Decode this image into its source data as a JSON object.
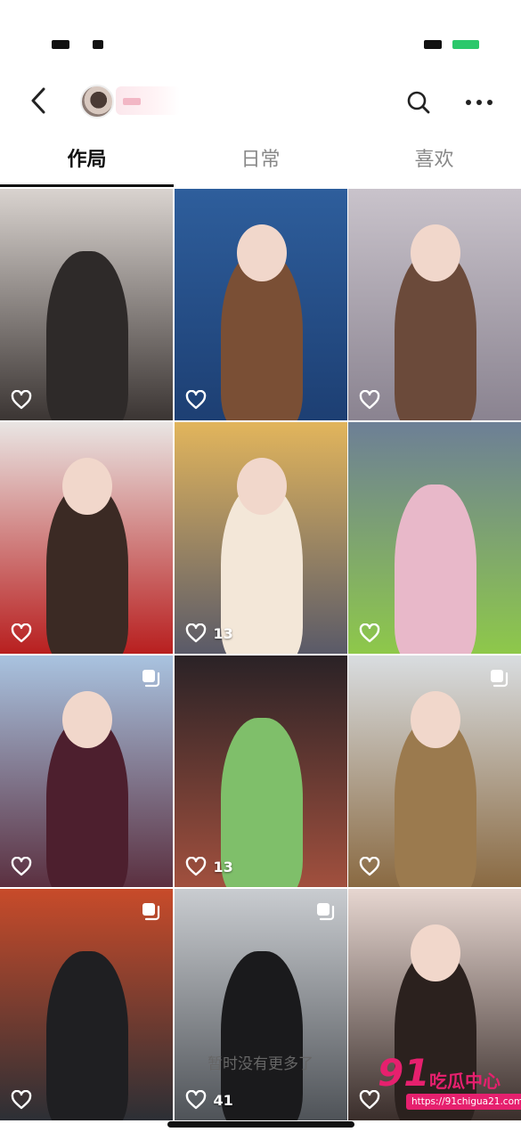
{
  "status_bar": {
    "left_blocks": 2,
    "battery_color": "#2bc86b"
  },
  "header": {
    "back_icon": "chevron-left-icon",
    "search_icon": "search-icon",
    "more_icon": "more-horizontal-icon"
  },
  "tabs": [
    {
      "label": "作局",
      "active": true
    },
    {
      "label": "日常",
      "active": false
    },
    {
      "label": "喜欢",
      "active": false
    }
  ],
  "grid": {
    "items": [
      {
        "likes": "",
        "multi": false,
        "bg": [
          "#d9d3cf",
          "#3b3533"
        ],
        "figure": "#2e2a29",
        "face": false
      },
      {
        "likes": "",
        "multi": false,
        "bg": [
          "#2e5e9c",
          "#1d3f73"
        ],
        "figure": "#7a4f35",
        "face": true
      },
      {
        "likes": "",
        "multi": false,
        "bg": [
          "#c9c3cb",
          "#8a8390"
        ],
        "figure": "#6b4a3a",
        "face": true
      },
      {
        "likes": "",
        "multi": false,
        "bg": [
          "#e9e5e3",
          "#b81f1f"
        ],
        "figure": "#3b2a24",
        "face": true
      },
      {
        "likes": "13",
        "multi": false,
        "bg": [
          "#e2b55c",
          "#5a5a68"
        ],
        "figure": "#f3e7d8",
        "face": true
      },
      {
        "likes": "",
        "multi": false,
        "bg": [
          "#6d7f96",
          "#8ec84a"
        ],
        "figure": "#e8b8c9",
        "face": false
      },
      {
        "likes": "",
        "multi": true,
        "bg": [
          "#a9c3e0",
          "#5b3040"
        ],
        "figure": "#4d1f2e",
        "face": true
      },
      {
        "likes": "13",
        "multi": false,
        "bg": [
          "#2a2226",
          "#a1503e"
        ],
        "figure": "#7fbf6a",
        "face": false
      },
      {
        "likes": "",
        "multi": true,
        "bg": [
          "#d9dde0",
          "#8a6a42"
        ],
        "figure": "#9b7a4e",
        "face": true
      },
      {
        "likes": "",
        "multi": true,
        "bg": [
          "#c84b2a",
          "#2c2f35"
        ],
        "figure": "#1f1f22",
        "face": false
      },
      {
        "likes": "41",
        "multi": true,
        "bg": [
          "#c9ccd0",
          "#4f5358"
        ],
        "figure": "#1a1a1c",
        "face": false
      },
      {
        "likes": "",
        "multi": false,
        "bg": [
          "#e6d6d0",
          "#3a2e2b"
        ],
        "figure": "#2b211e",
        "face": true
      }
    ]
  },
  "footer": {
    "text": "暂时没有更多了"
  },
  "watermark": {
    "number": "91",
    "title": "吃瓜中心",
    "url": "https://91chigua21.com",
    "color": "#e6206e"
  }
}
